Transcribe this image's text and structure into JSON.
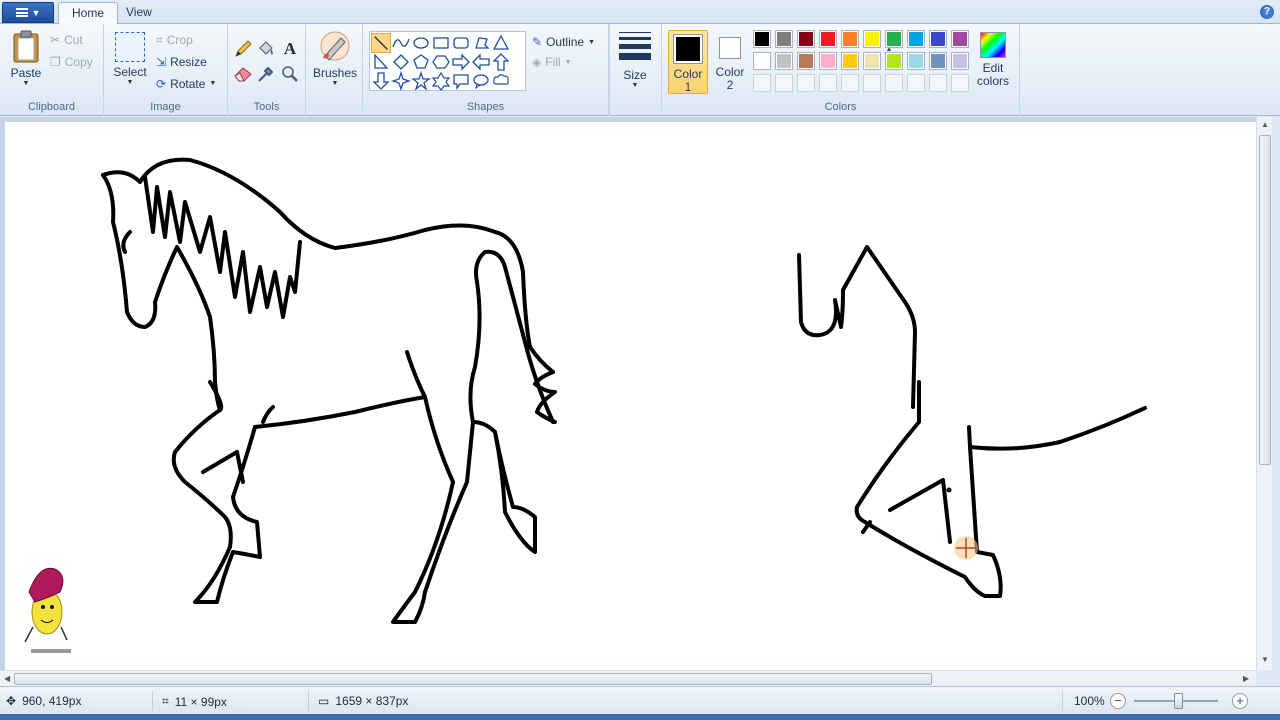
{
  "tabs": {
    "home": "Home",
    "view": "View"
  },
  "help_icon": "?",
  "clipboard": {
    "paste": "Paste",
    "cut": "Cut",
    "copy": "Copy",
    "group_label": "Clipboard"
  },
  "image": {
    "select": "Select",
    "crop": "Crop",
    "resize": "Resize",
    "rotate": "Rotate",
    "group_label": "Image"
  },
  "tools": {
    "group_label": "Tools"
  },
  "brushes": {
    "label": "Brushes"
  },
  "shapes": {
    "outline": "Outline",
    "fill": "Fill",
    "group_label": "Shapes"
  },
  "size": {
    "label": "Size"
  },
  "colors": {
    "color1": "Color\n1",
    "color1_a": "Color",
    "color1_b": "1",
    "color2_a": "Color",
    "color2_b": "2",
    "edit_a": "Edit",
    "edit_b": "colors",
    "group_label": "Colors",
    "color1_value": "#000000",
    "color2_value": "#ffffff",
    "palette_row1": [
      "#000000",
      "#7f7f7f",
      "#880015",
      "#ed1c24",
      "#ff7f27",
      "#fff200",
      "#22b14c",
      "#00a2e8",
      "#3f48cc",
      "#a349a4"
    ],
    "palette_row2": [
      "#ffffff",
      "#c3c3c3",
      "#b97a57",
      "#ffaec9",
      "#ffc90e",
      "#efe4b0",
      "#b5e61d",
      "#99d9ea",
      "#7092be",
      "#c8bfe7"
    ]
  },
  "status": {
    "cursor_pos": "960, 419px",
    "selection_size": "11 × 99px",
    "image_size": "1659 × 837px",
    "zoom": "100%"
  },
  "icons": {
    "app_menu": "menu-icon",
    "paste": "clipboard-icon",
    "cut": "scissors-icon",
    "copy": "copy-icon",
    "crop": "crop-icon",
    "resize": "resize-icon",
    "rotate": "rotate-icon",
    "pencil": "pencil-icon",
    "fill": "bucket-icon",
    "text": "text-icon",
    "eraser": "eraser-icon",
    "picker": "color-picker-icon",
    "magnifier": "magnifier-icon"
  }
}
